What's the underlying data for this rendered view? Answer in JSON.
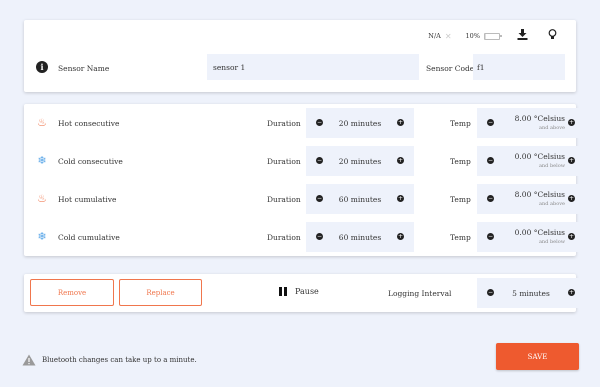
{
  "status": {
    "signal": "N/A",
    "battery": "10%",
    "battery_fill": 0.1,
    "icons": [
      "bluetooth-off-icon",
      "battery-icon",
      "download-icon",
      "lightbulb-icon"
    ]
  },
  "sensor": {
    "name_label": "Sensor Name",
    "name_value": "sensor 1",
    "code_label": "Sensor Code",
    "code_value": "f1"
  },
  "alarms": [
    {
      "name": "Hot consecutive",
      "icon": "hot-icon",
      "duration_label": "Duration",
      "duration": "20 minutes",
      "temp_label": "Temp",
      "temp": "8.00 °Celsius",
      "temp_sub": "and above"
    },
    {
      "name": "Cold consecutive",
      "icon": "cold-icon",
      "duration_label": "Duration",
      "duration": "20 minutes",
      "temp_label": "Temp",
      "temp": "0.00 °Celsius",
      "temp_sub": "and below"
    },
    {
      "name": "Hot cumulative",
      "icon": "hot-icon",
      "duration_label": "Duration",
      "duration": "60 minutes",
      "temp_label": "Temp",
      "temp": "8.00 °Celsius",
      "temp_sub": "and above"
    },
    {
      "name": "Cold cumulative",
      "icon": "cold-icon",
      "duration_label": "Duration",
      "duration": "60 minutes",
      "temp_label": "Temp",
      "temp": "0.00 °Celsius",
      "temp_sub": "and below"
    }
  ],
  "controls": {
    "remove": "Remove",
    "replace": "Replace",
    "pause": "Pause",
    "logging_label": "Logging Interval",
    "logging_value": "5 minutes"
  },
  "footer": {
    "warning": "Bluetooth changes can take up to a minute.",
    "save": "SAVE"
  },
  "colors": {
    "accent": "#ee5a2f",
    "hot": "#f0764d",
    "cold": "#5aa7e8",
    "background": "#eef2fb"
  }
}
